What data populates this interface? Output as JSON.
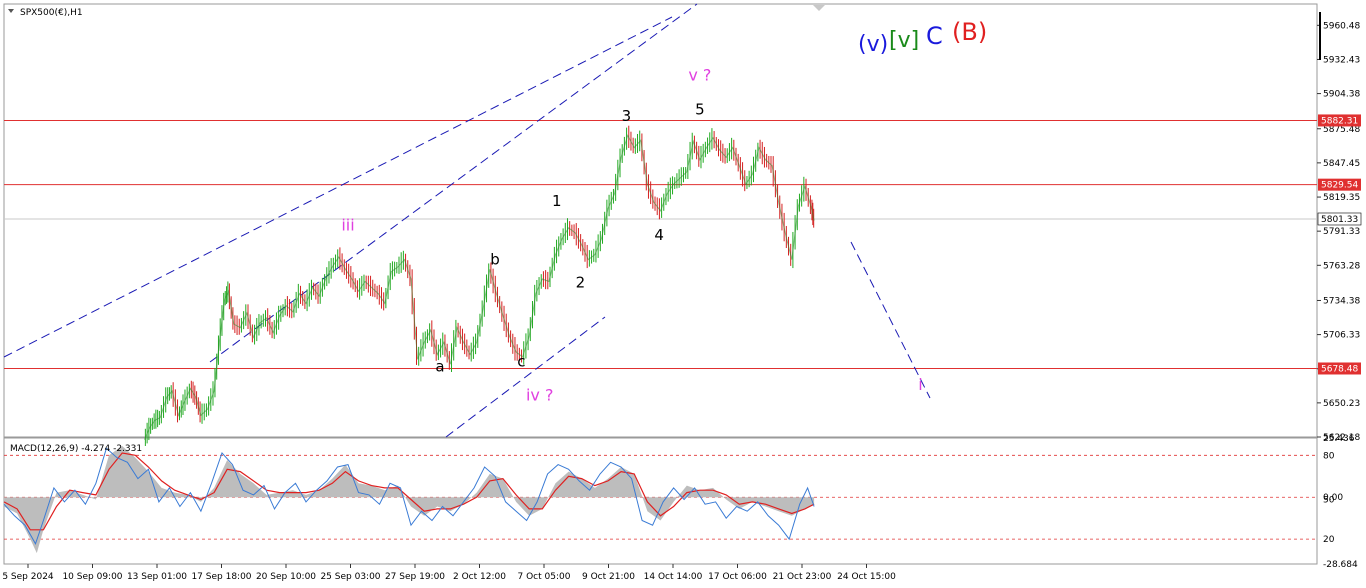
{
  "chart_data": {
    "type": "line",
    "symbol_label": "SPX500(€),H1",
    "macd_label": "MACD(12,26,9) -4.274 -2.331",
    "price_axis": {
      "ylim": [
        5622.18,
        5978
      ],
      "ticks": [
        "5960.48",
        "5932.43",
        "5904.38",
        "5875.48",
        "5847.45",
        "5819.35",
        "5791.33",
        "5763.28",
        "5734.38",
        "5706.33",
        "5678.25",
        "5650.23",
        "5622.18"
      ]
    },
    "macd_axis": {
      "ylim": [
        -28.684,
        25.436
      ],
      "ticks": [
        "25.436",
        "80",
        "0.00",
        "50",
        "20",
        "-28.684"
      ],
      "tick_values": [
        25.436,
        18,
        0,
        -1,
        -18,
        -28.684
      ]
    },
    "x_ticks": [
      "5 Sep 2024",
      "10 Sep 09:00",
      "13 Sep 01:00",
      "17 Sep 18:00",
      "20 Sep 10:00",
      "25 Sep 03:00",
      "27 Sep 19:00",
      "2 Oct 12:00",
      "7 Oct 05:00",
      "9 Oct 21:00",
      "14 Oct 14:00",
      "17 Oct 06:00",
      "21 Oct 23:00",
      "24 Oct 15:00"
    ],
    "horizontal_levels": [
      {
        "value": 5882.31,
        "label": "5882.31",
        "color": "#e03030",
        "boxed": true
      },
      {
        "value": 5829.54,
        "label": "5829.54",
        "color": "#e03030",
        "boxed": true
      },
      {
        "value": 5801.33,
        "label": "5801.33",
        "color": "#c8c8c8",
        "boxed": false
      },
      {
        "value": 5678.48,
        "label": "5678.48",
        "color": "#e03030",
        "boxed": true
      }
    ],
    "price_path": [
      [
        0.107,
        5620
      ],
      [
        0.111,
        5630
      ],
      [
        0.115,
        5636
      ],
      [
        0.119,
        5638
      ],
      [
        0.124,
        5655
      ],
      [
        0.128,
        5660
      ],
      [
        0.133,
        5640
      ],
      [
        0.137,
        5650
      ],
      [
        0.142,
        5662
      ],
      [
        0.146,
        5655
      ],
      [
        0.15,
        5640
      ],
      [
        0.155,
        5645
      ],
      [
        0.16,
        5660
      ],
      [
        0.164,
        5700
      ],
      [
        0.168,
        5735
      ],
      [
        0.171,
        5742
      ],
      [
        0.175,
        5715
      ],
      [
        0.18,
        5712
      ],
      [
        0.185,
        5724
      ],
      [
        0.19,
        5704
      ],
      [
        0.195,
        5716
      ],
      [
        0.2,
        5720
      ],
      [
        0.205,
        5708
      ],
      [
        0.21,
        5722
      ],
      [
        0.215,
        5730
      ],
      [
        0.22,
        5725
      ],
      [
        0.225,
        5740
      ],
      [
        0.23,
        5732
      ],
      [
        0.235,
        5745
      ],
      [
        0.24,
        5738
      ],
      [
        0.245,
        5752
      ],
      [
        0.25,
        5762
      ],
      [
        0.255,
        5770
      ],
      [
        0.26,
        5760
      ],
      [
        0.265,
        5752
      ],
      [
        0.27,
        5742
      ],
      [
        0.275,
        5750
      ],
      [
        0.28,
        5745
      ],
      [
        0.285,
        5740
      ],
      [
        0.29,
        5732
      ],
      [
        0.295,
        5758
      ],
      [
        0.3,
        5762
      ],
      [
        0.305,
        5768
      ],
      [
        0.31,
        5752
      ],
      [
        0.315,
        5686
      ],
      [
        0.32,
        5700
      ],
      [
        0.325,
        5710
      ],
      [
        0.33,
        5690
      ],
      [
        0.335,
        5700
      ],
      [
        0.34,
        5682
      ],
      [
        0.345,
        5712
      ],
      [
        0.35,
        5700
      ],
      [
        0.355,
        5690
      ],
      [
        0.36,
        5700
      ],
      [
        0.365,
        5728
      ],
      [
        0.37,
        5760
      ],
      [
        0.375,
        5740
      ],
      [
        0.38,
        5722
      ],
      [
        0.385,
        5705
      ],
      [
        0.39,
        5692
      ],
      [
        0.395,
        5688
      ],
      [
        0.4,
        5705
      ],
      [
        0.405,
        5740
      ],
      [
        0.41,
        5752
      ],
      [
        0.415,
        5750
      ],
      [
        0.42,
        5772
      ],
      [
        0.425,
        5785
      ],
      [
        0.43,
        5794
      ],
      [
        0.435,
        5790
      ],
      [
        0.44,
        5780
      ],
      [
        0.445,
        5768
      ],
      [
        0.45,
        5772
      ],
      [
        0.455,
        5785
      ],
      [
        0.46,
        5810
      ],
      [
        0.465,
        5822
      ],
      [
        0.47,
        5852
      ],
      [
        0.475,
        5870
      ],
      [
        0.48,
        5860
      ],
      [
        0.485,
        5866
      ],
      [
        0.49,
        5830
      ],
      [
        0.495,
        5815
      ],
      [
        0.5,
        5808
      ],
      [
        0.505,
        5822
      ],
      [
        0.51,
        5830
      ],
      [
        0.515,
        5835
      ],
      [
        0.52,
        5840
      ],
      [
        0.525,
        5865
      ],
      [
        0.53,
        5850
      ],
      [
        0.535,
        5860
      ],
      [
        0.54,
        5868
      ],
      [
        0.545,
        5858
      ],
      [
        0.55,
        5852
      ],
      [
        0.555,
        5860
      ],
      [
        0.56,
        5845
      ],
      [
        0.565,
        5830
      ],
      [
        0.57,
        5838
      ],
      [
        0.575,
        5860
      ],
      [
        0.58,
        5850
      ],
      [
        0.585,
        5845
      ],
      [
        0.59,
        5815
      ],
      [
        0.595,
        5790
      ],
      [
        0.6,
        5768
      ],
      [
        0.605,
        5812
      ],
      [
        0.61,
        5828
      ],
      [
        0.615,
        5810
      ],
      [
        0.617,
        5800
      ]
    ],
    "macd_hist": [
      [
        0.0,
        -4
      ],
      [
        0.01,
        -7
      ],
      [
        0.02,
        -18
      ],
      [
        0.025,
        -24
      ],
      [
        0.03,
        -14
      ],
      [
        0.04,
        2
      ],
      [
        0.05,
        3
      ],
      [
        0.06,
        1
      ],
      [
        0.07,
        -1
      ],
      [
        0.08,
        18
      ],
      [
        0.09,
        22
      ],
      [
        0.1,
        17
      ],
      [
        0.11,
        11
      ],
      [
        0.12,
        4
      ],
      [
        0.13,
        2
      ],
      [
        0.14,
        1
      ],
      [
        0.15,
        -2
      ],
      [
        0.16,
        4
      ],
      [
        0.17,
        16
      ],
      [
        0.18,
        10
      ],
      [
        0.19,
        6
      ],
      [
        0.2,
        1
      ],
      [
        0.21,
        2
      ],
      [
        0.22,
        3
      ],
      [
        0.23,
        1
      ],
      [
        0.24,
        3
      ],
      [
        0.25,
        8
      ],
      [
        0.26,
        14
      ],
      [
        0.27,
        6
      ],
      [
        0.28,
        5
      ],
      [
        0.29,
        3
      ],
      [
        0.3,
        5
      ],
      [
        0.31,
        -4
      ],
      [
        0.32,
        -8
      ],
      [
        0.33,
        -4
      ],
      [
        0.34,
        -6
      ],
      [
        0.35,
        -3
      ],
      [
        0.36,
        2
      ],
      [
        0.37,
        10
      ],
      [
        0.38,
        8
      ],
      [
        0.39,
        -2
      ],
      [
        0.4,
        -8
      ],
      [
        0.41,
        -5
      ],
      [
        0.42,
        6
      ],
      [
        0.43,
        11
      ],
      [
        0.44,
        8
      ],
      [
        0.45,
        4
      ],
      [
        0.46,
        8
      ],
      [
        0.47,
        13
      ],
      [
        0.48,
        10
      ],
      [
        0.49,
        -6
      ],
      [
        0.5,
        -10
      ],
      [
        0.51,
        -2
      ],
      [
        0.52,
        5
      ],
      [
        0.53,
        3
      ],
      [
        0.54,
        4
      ],
      [
        0.55,
        -1
      ],
      [
        0.56,
        -5
      ],
      [
        0.57,
        -2
      ],
      [
        0.58,
        -4
      ],
      [
        0.59,
        -6
      ],
      [
        0.6,
        -8
      ],
      [
        0.61,
        -5
      ],
      [
        0.617,
        -3
      ]
    ],
    "macd_signal": [
      [
        0.0,
        -2
      ],
      [
        0.01,
        -5
      ],
      [
        0.02,
        -14
      ],
      [
        0.03,
        -14
      ],
      [
        0.04,
        -4
      ],
      [
        0.05,
        3
      ],
      [
        0.06,
        2
      ],
      [
        0.07,
        1
      ],
      [
        0.08,
        12
      ],
      [
        0.09,
        19
      ],
      [
        0.1,
        18
      ],
      [
        0.11,
        13
      ],
      [
        0.12,
        7
      ],
      [
        0.13,
        3
      ],
      [
        0.14,
        1
      ],
      [
        0.15,
        -1
      ],
      [
        0.16,
        2
      ],
      [
        0.17,
        12
      ],
      [
        0.18,
        11
      ],
      [
        0.19,
        7
      ],
      [
        0.2,
        3
      ],
      [
        0.21,
        2
      ],
      [
        0.22,
        2
      ],
      [
        0.23,
        2
      ],
      [
        0.24,
        3
      ],
      [
        0.25,
        6
      ],
      [
        0.26,
        11
      ],
      [
        0.27,
        7
      ],
      [
        0.28,
        5
      ],
      [
        0.29,
        4
      ],
      [
        0.3,
        4
      ],
      [
        0.31,
        -1
      ],
      [
        0.32,
        -6
      ],
      [
        0.33,
        -5
      ],
      [
        0.34,
        -5
      ],
      [
        0.35,
        -3
      ],
      [
        0.36,
        0
      ],
      [
        0.37,
        7
      ],
      [
        0.38,
        8
      ],
      [
        0.39,
        1
      ],
      [
        0.4,
        -5
      ],
      [
        0.41,
        -5
      ],
      [
        0.42,
        3
      ],
      [
        0.43,
        9
      ],
      [
        0.44,
        8
      ],
      [
        0.45,
        5
      ],
      [
        0.46,
        7
      ],
      [
        0.47,
        11
      ],
      [
        0.48,
        10
      ],
      [
        0.49,
        -2
      ],
      [
        0.5,
        -8
      ],
      [
        0.51,
        -4
      ],
      [
        0.52,
        2
      ],
      [
        0.53,
        3
      ],
      [
        0.54,
        3
      ],
      [
        0.55,
        1
      ],
      [
        0.56,
        -3
      ],
      [
        0.57,
        -2
      ],
      [
        0.58,
        -3
      ],
      [
        0.59,
        -5
      ],
      [
        0.6,
        -7
      ],
      [
        0.61,
        -5
      ],
      [
        0.617,
        -3
      ]
    ],
    "macd_line": [
      [
        0.0,
        -3
      ],
      [
        0.008,
        -8
      ],
      [
        0.016,
        -12
      ],
      [
        0.024,
        -20
      ],
      [
        0.03,
        -10
      ],
      [
        0.038,
        4
      ],
      [
        0.046,
        -2
      ],
      [
        0.054,
        3
      ],
      [
        0.062,
        -3
      ],
      [
        0.07,
        6
      ],
      [
        0.078,
        21
      ],
      [
        0.086,
        17
      ],
      [
        0.094,
        15
      ],
      [
        0.102,
        8
      ],
      [
        0.11,
        12
      ],
      [
        0.118,
        -2
      ],
      [
        0.126,
        4
      ],
      [
        0.134,
        -4
      ],
      [
        0.142,
        2
      ],
      [
        0.15,
        -6
      ],
      [
        0.158,
        6
      ],
      [
        0.166,
        19
      ],
      [
        0.174,
        14
      ],
      [
        0.182,
        3
      ],
      [
        0.19,
        1
      ],
      [
        0.198,
        5
      ],
      [
        0.206,
        -5
      ],
      [
        0.214,
        2
      ],
      [
        0.222,
        6
      ],
      [
        0.23,
        -2
      ],
      [
        0.238,
        3
      ],
      [
        0.246,
        7
      ],
      [
        0.254,
        13
      ],
      [
        0.262,
        14
      ],
      [
        0.27,
        2
      ],
      [
        0.278,
        1
      ],
      [
        0.286,
        -3
      ],
      [
        0.294,
        6
      ],
      [
        0.302,
        4
      ],
      [
        0.31,
        -12
      ],
      [
        0.318,
        -6
      ],
      [
        0.326,
        -10
      ],
      [
        0.334,
        -4
      ],
      [
        0.342,
        -8
      ],
      [
        0.35,
        -2
      ],
      [
        0.358,
        4
      ],
      [
        0.366,
        13
      ],
      [
        0.374,
        9
      ],
      [
        0.382,
        -2
      ],
      [
        0.39,
        -6
      ],
      [
        0.398,
        -10
      ],
      [
        0.406,
        -2
      ],
      [
        0.414,
        10
      ],
      [
        0.422,
        14
      ],
      [
        0.43,
        12
      ],
      [
        0.438,
        7
      ],
      [
        0.446,
        3
      ],
      [
        0.454,
        10
      ],
      [
        0.462,
        15
      ],
      [
        0.47,
        13
      ],
      [
        0.478,
        8
      ],
      [
        0.486,
        -10
      ],
      [
        0.494,
        -12
      ],
      [
        0.502,
        -2
      ],
      [
        0.51,
        4
      ],
      [
        0.518,
        -1
      ],
      [
        0.526,
        4
      ],
      [
        0.534,
        -3
      ],
      [
        0.542,
        -2
      ],
      [
        0.55,
        -9
      ],
      [
        0.558,
        -4
      ],
      [
        0.566,
        -6
      ],
      [
        0.574,
        -2
      ],
      [
        0.582,
        -8
      ],
      [
        0.59,
        -12
      ],
      [
        0.598,
        -18
      ],
      [
        0.606,
        -3
      ],
      [
        0.612,
        4
      ],
      [
        0.617,
        -4
      ]
    ],
    "wave_labels": [
      {
        "text": "iii",
        "x": 0.262,
        "price": 5792,
        "color": "#e040e0",
        "size": 16
      },
      {
        "text": "iv ?",
        "x": 0.408,
        "price": 5652,
        "color": "#e040e0",
        "size": 16
      },
      {
        "text": "v ?",
        "x": 0.53,
        "price": 5915,
        "color": "#e040e0",
        "size": 16
      },
      {
        "text": "i",
        "x": 0.698,
        "price": 5661,
        "color": "#e040e0",
        "size": 16
      },
      {
        "text": "a",
        "x": 0.332,
        "price": 5676,
        "color": "#000000",
        "size": 15
      },
      {
        "text": "b",
        "x": 0.374,
        "price": 5764,
        "color": "#000000",
        "size": 15
      },
      {
        "text": "c",
        "x": 0.394,
        "price": 5680,
        "color": "#000000",
        "size": 15
      },
      {
        "text": "1",
        "x": 0.421,
        "price": 5812,
        "color": "#000000",
        "size": 15
      },
      {
        "text": "2",
        "x": 0.439,
        "price": 5745,
        "color": "#000000",
        "size": 15
      },
      {
        "text": "3",
        "x": 0.474,
        "price": 5882,
        "color": "#000000",
        "size": 15
      },
      {
        "text": "4",
        "x": 0.499,
        "price": 5784,
        "color": "#000000",
        "size": 15
      },
      {
        "text": "5",
        "x": 0.53,
        "price": 5887,
        "color": "#000000",
        "size": 15
      }
    ],
    "degree_labels": [
      {
        "text": "(v)",
        "color": "#1a1adc"
      },
      {
        "text": "[v]",
        "color": "#1a8a1a"
      },
      {
        "text": "C",
        "color": "#1a1adc"
      },
      {
        "text": "(B)",
        "color": "#e02020"
      }
    ],
    "colors": {
      "up": "#22aa22",
      "down": "#d42020",
      "channel": "#1a1ab4",
      "level_red": "#e03030",
      "hist": "#bdbdbd",
      "signal": "#e02020",
      "macd": "#3a7bd5"
    }
  }
}
